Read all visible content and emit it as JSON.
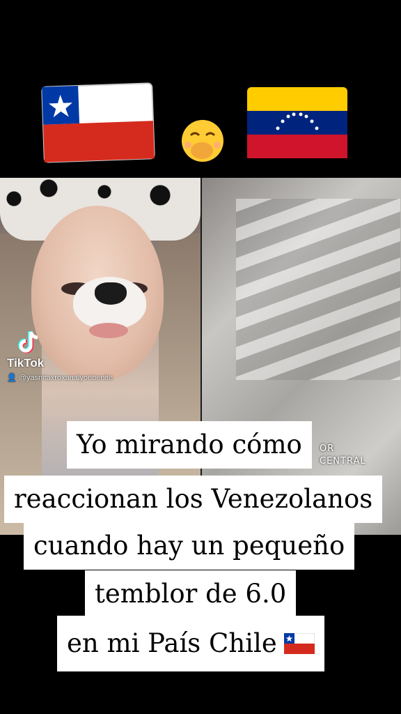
{
  "header": {
    "left_icon": "chile-flag-icon",
    "middle_icon": "face-with-hand-over-mouth-icon",
    "right_icon": "venezuela-flag-icon"
  },
  "video": {
    "watermark_brand": "TikTok",
    "watermark_user": "@yasnitaxroxanalyonbenite",
    "right_pane_text_1": "OR",
    "right_pane_text_2": "CENTRAL"
  },
  "caption": {
    "line1": "Yo mirando cómo",
    "line2": "reaccionan los Venezolanos",
    "line3": "cuando hay un pequeño",
    "line4": "temblor de 6.0",
    "line5": "en mi País Chile",
    "line5_icon": "chile-flag-icon"
  },
  "colors": {
    "chile_red": "#d52b1e",
    "chile_blue": "#0039a6",
    "venezuela_yellow": "#ffcc00",
    "venezuela_blue": "#00247d",
    "venezuela_red": "#cf142b"
  }
}
